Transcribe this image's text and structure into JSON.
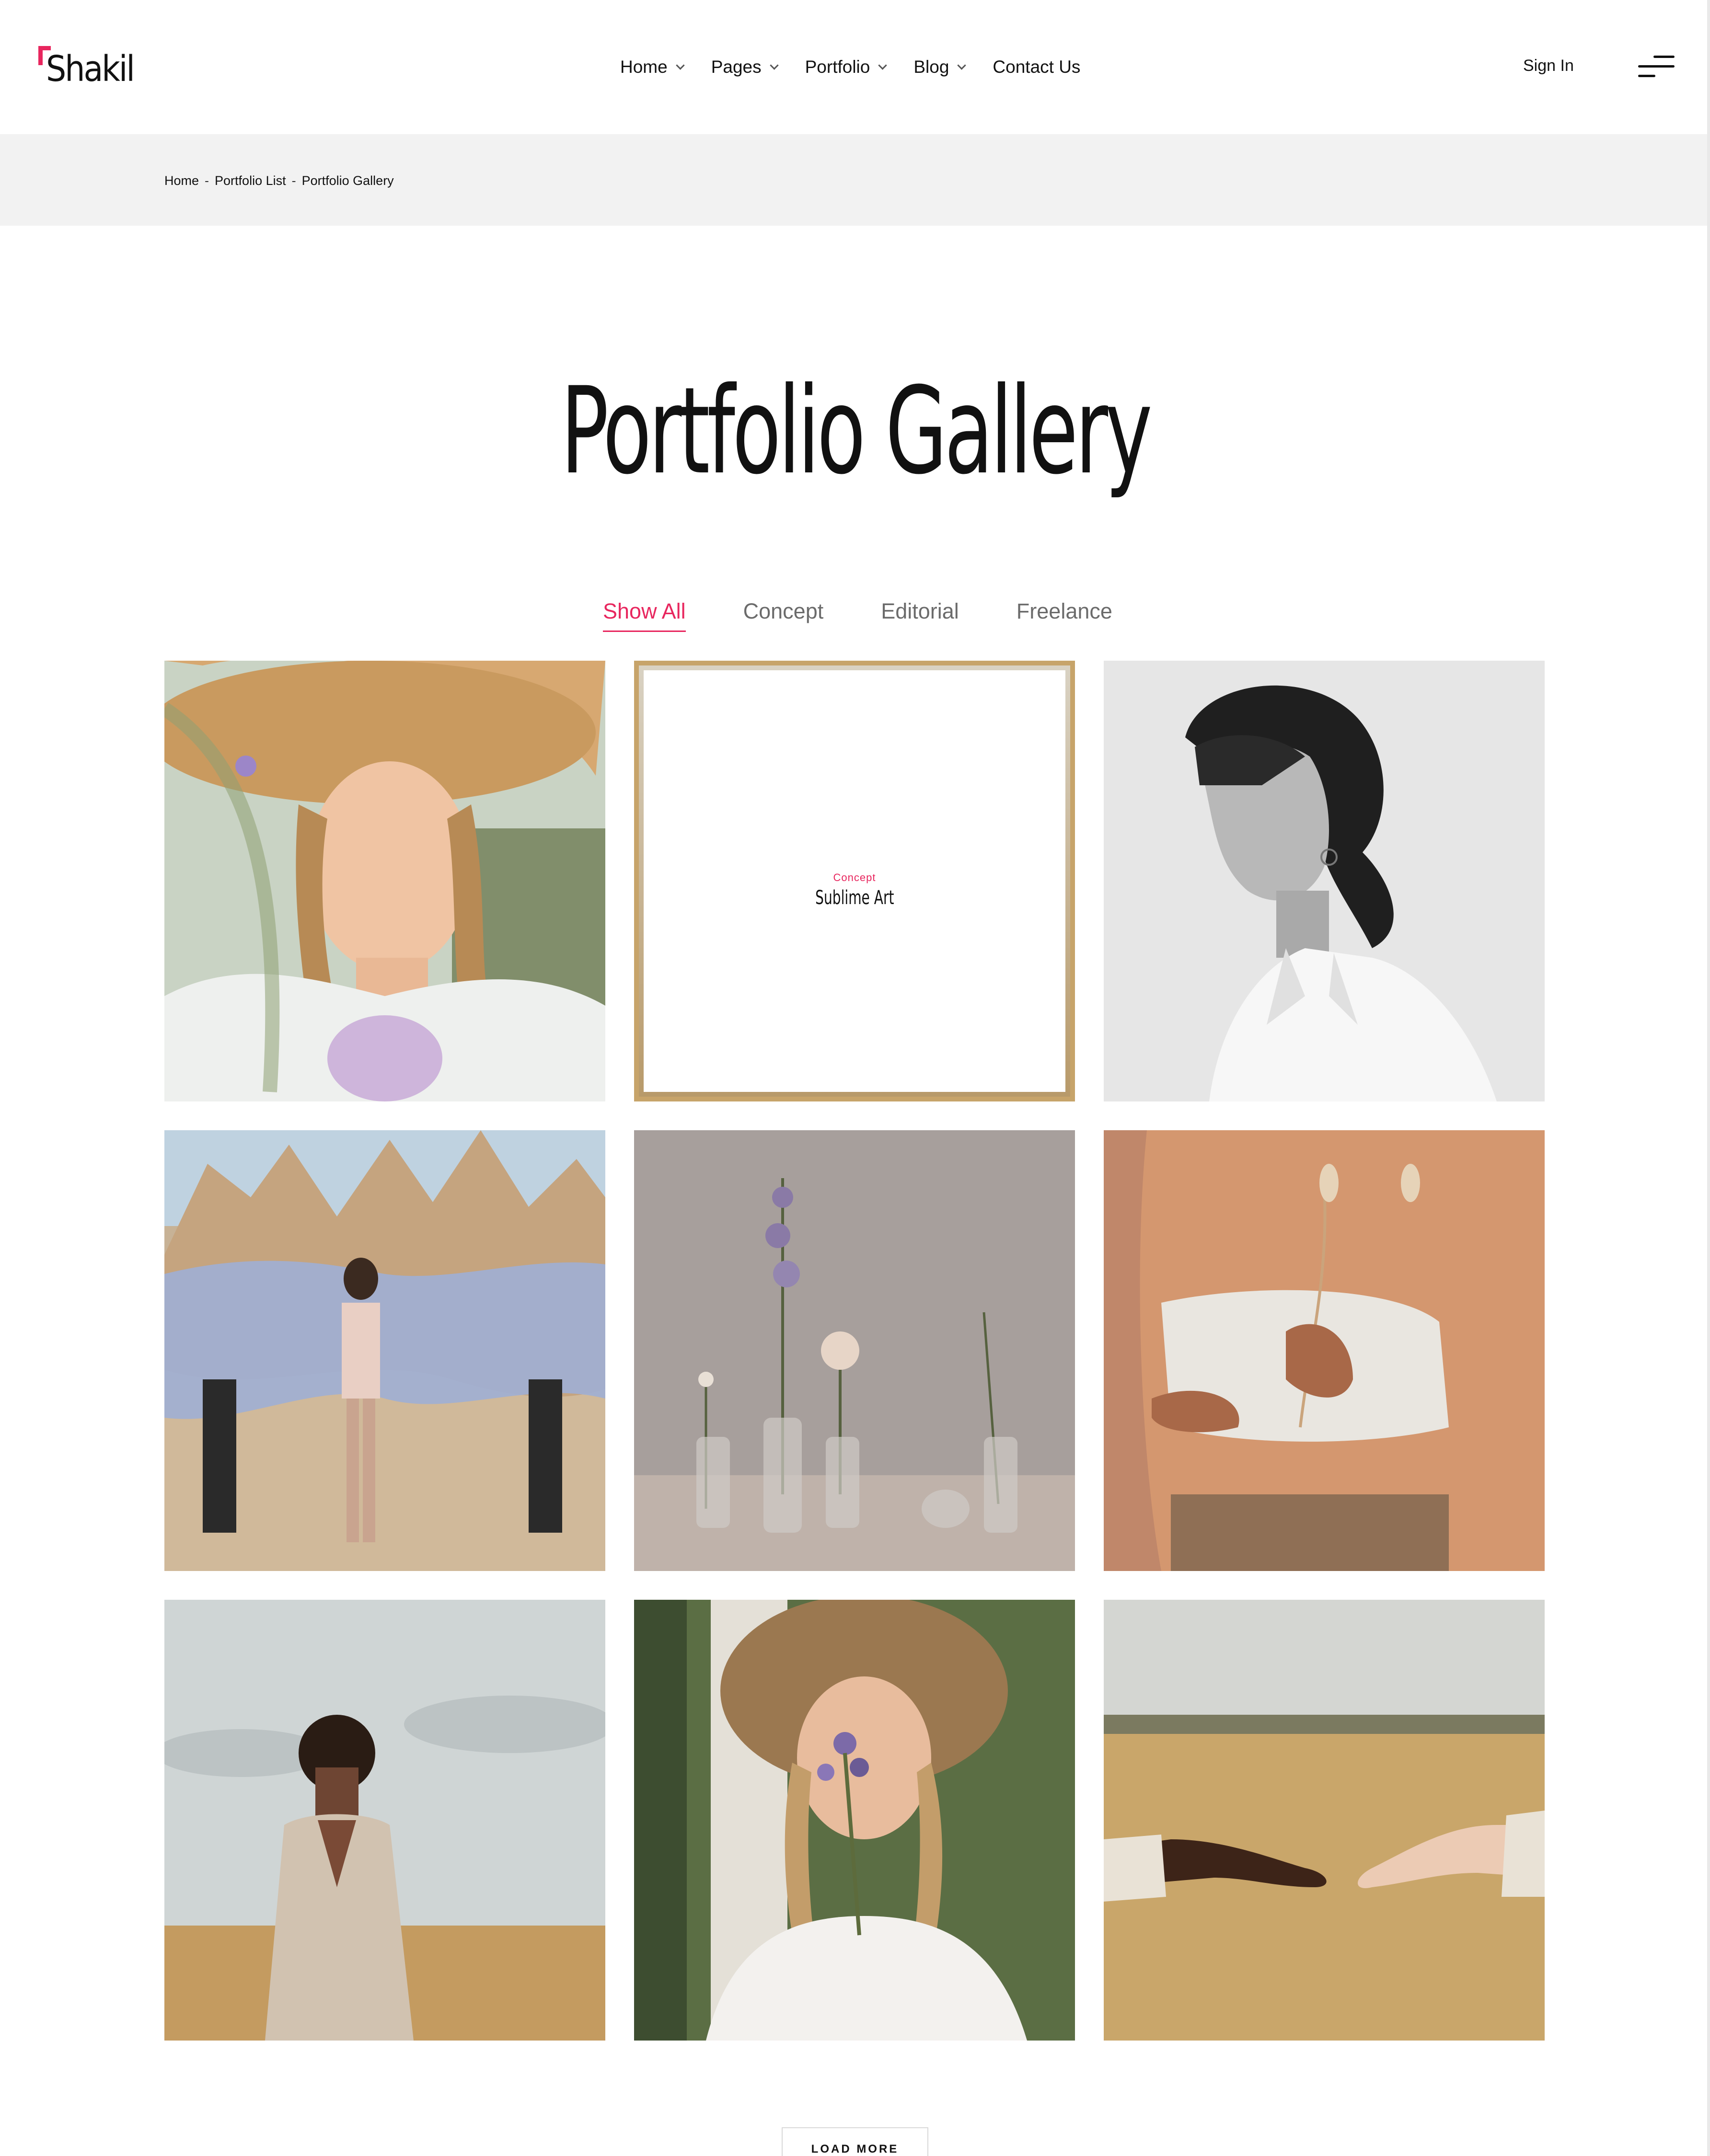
{
  "brand": {
    "name": "Shakil",
    "accent": "#e8265e"
  },
  "nav": {
    "items": [
      {
        "label": "Home",
        "has_dropdown": true
      },
      {
        "label": "Pages",
        "has_dropdown": true
      },
      {
        "label": "Portfolio",
        "has_dropdown": true
      },
      {
        "label": "Blog",
        "has_dropdown": true
      },
      {
        "label": "Contact Us",
        "has_dropdown": false
      }
    ],
    "sign_in": "Sign In",
    "menu_icon": "hamburger-icon"
  },
  "breadcrumb": {
    "items": [
      "Home",
      "Portfolio List",
      "Portfolio Gallery"
    ],
    "separator": "-"
  },
  "page": {
    "title": "Portfolio Gallery"
  },
  "filters": {
    "tabs": [
      "Show All",
      "Concept",
      "Editorial",
      "Freelance"
    ],
    "active": "Show All"
  },
  "gallery": {
    "hovered_item": {
      "category": "Concept",
      "title": "Sublime Art"
    },
    "items": [
      {
        "image": "woman-straw-hat-photo"
      },
      {
        "image": "hover-card",
        "category": "Concept",
        "title": "Sublime Art"
      },
      {
        "image": "woman-profile-bw-photo"
      },
      {
        "image": "desert-fabric-group-photo"
      },
      {
        "image": "flowers-in-vases-photo"
      },
      {
        "image": "dried-flowers-torso-photo"
      },
      {
        "image": "man-in-field-photo"
      },
      {
        "image": "woman-birch-flowers-photo"
      },
      {
        "image": "hands-reaching-field-photo"
      }
    ]
  },
  "load_more": {
    "label": "LOAD MORE"
  }
}
